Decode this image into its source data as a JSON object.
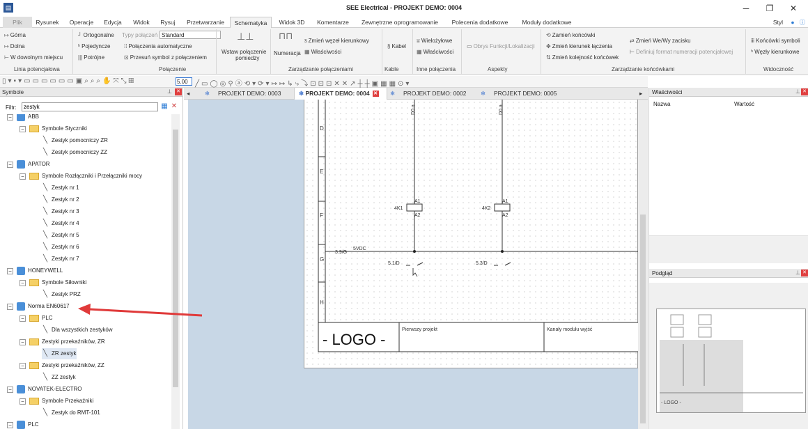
{
  "app": {
    "title": "SEE Electrical - PROJEKT DEMO: 0004",
    "style_label": "Styl"
  },
  "ribbon_tabs": [
    "Plik",
    "Rysunek",
    "Operacje",
    "Edycja",
    "Widok",
    "Rysuj",
    "Przetwarzanie",
    "Schematyka",
    "Widok 3D",
    "Komentarze",
    "Zewnętrzne oprogramowanie",
    "Polecenia dodatkowe",
    "Moduły dodatkowe"
  ],
  "ribbon": {
    "linia": {
      "gorna": "Górna",
      "dolna": "Dolna",
      "dowolne": "W dowolnym miejscu",
      "label": "Linia potencjałowa"
    },
    "polaczenie": {
      "ortogonalne": "Ortogonalne",
      "typy": "Typy połączeń",
      "combo": "Standard",
      "pojedyncze": "Pojedyncze",
      "automatyczne": "Połączenia automatyczne",
      "potrojne": "Potrójne",
      "przesun": "Przesuń symbol z połączeniem",
      "label": "Połączenie"
    },
    "wstaw": {
      "line1": "Wstaw połączenie",
      "line2": "pomiedzy"
    },
    "numeracja": "Numeracja",
    "zarzadzanie": {
      "zmien_wezel": "Zmień węzeł kierunkowy",
      "wlasciwosci": "Właściwości",
      "label": "Zarządzanie połączeniami"
    },
    "kabel": {
      "kabel": "Kabel",
      "label": "Kable"
    },
    "inne": {
      "wielozylowe": "Wielożyłowe",
      "wlasciwosci": "Właściwości",
      "label": "Inne połączenia"
    },
    "aspekty": {
      "obrys": "Obrys Funkcji/Lokalizacji",
      "label": "Aspekty"
    },
    "koncowki": {
      "zamien": "Zamień końcówki",
      "kierunek": "Zmień kierunek łączenia",
      "kolejnosc": "Zmień kolejność końcówek",
      "we_wy": "Zmień We/Wy zacisku",
      "format": "Definiuj format numeracji potencjałowej",
      "label": "Zarządzanie końcówkami"
    },
    "widocznosc": {
      "symbole": "Końcówki symboli",
      "wezly": "Węzły kierunkowe",
      "label": "Widoczność"
    }
  },
  "toolbar": {
    "zoom": "5.00"
  },
  "symbols_panel": {
    "title": "Symbole",
    "filter_label": "Filtr:",
    "filter_value": "zestyk",
    "tree": [
      {
        "level": 0,
        "type": "lib",
        "label": "ABB"
      },
      {
        "level": 1,
        "type": "folder",
        "label": "Symbole Styczniki"
      },
      {
        "level": 2,
        "type": "sym",
        "label": "Zestyk pomocniczy ZR"
      },
      {
        "level": 2,
        "type": "sym",
        "label": "Zestyk pomocniczy ZZ"
      },
      {
        "level": 0,
        "type": "lib",
        "label": "APATOR"
      },
      {
        "level": 1,
        "type": "folder",
        "label": "Symbole Rozłączniki i Przełączniki mocy"
      },
      {
        "level": 2,
        "type": "sym",
        "label": "Zestyk nr 1"
      },
      {
        "level": 2,
        "type": "sym",
        "label": "Zestyk nr 2"
      },
      {
        "level": 2,
        "type": "sym",
        "label": "Zestyk nr 3"
      },
      {
        "level": 2,
        "type": "sym",
        "label": "Zestyk nr 4"
      },
      {
        "level": 2,
        "type": "sym",
        "label": "Zestyk nr 5"
      },
      {
        "level": 2,
        "type": "sym",
        "label": "Zestyk nr 6"
      },
      {
        "level": 2,
        "type": "sym",
        "label": "Zestyk nr 7"
      },
      {
        "level": 0,
        "type": "lib",
        "label": "HONEYWELL"
      },
      {
        "level": 1,
        "type": "folder",
        "label": "Symbole Siłowniki"
      },
      {
        "level": 2,
        "type": "sym",
        "label": "Zestyk PRZ"
      },
      {
        "level": 0,
        "type": "lib",
        "label": "Norma EN60617"
      },
      {
        "level": 1,
        "type": "folder",
        "label": "PLC"
      },
      {
        "level": 2,
        "type": "sym",
        "label": "Dla wszystkich zestyków"
      },
      {
        "level": 1,
        "type": "folder",
        "label": "Zestyki przekaźników, ZR"
      },
      {
        "level": 2,
        "type": "sym",
        "label": "ZR zestyk",
        "selected": true
      },
      {
        "level": 1,
        "type": "folder",
        "label": "Zestyki przekaźników, ZZ"
      },
      {
        "level": 2,
        "type": "sym",
        "label": "ZZ zestyk"
      },
      {
        "level": 0,
        "type": "lib",
        "label": "NOVATEK-ELECTRO"
      },
      {
        "level": 1,
        "type": "folder",
        "label": "Symbole Przekaźniki"
      },
      {
        "level": 2,
        "type": "sym",
        "label": "Zestyk do RMT-101"
      },
      {
        "level": 0,
        "type": "lib",
        "label": "PLC"
      }
    ]
  },
  "doc_tabs": [
    "PROJEKT DEMO: 0003",
    "PROJEKT DEMO: 0004",
    "PROJEKT DEMO: 0002",
    "PROJEKT DEMO: 0005"
  ],
  "schematic": {
    "rows": [
      "D",
      "E",
      "F",
      "G",
      "H"
    ],
    "coil1": "4K1",
    "coil2": "4K2",
    "a1": "A1",
    "a2": "A2",
    "top1": "D0.a",
    "top2": "D0.a",
    "supply_ref": "3.9/G",
    "supply": "5VDC",
    "ref1": "5.1/D",
    "ref2": "5.3/D",
    "logo": "- LOGO -",
    "project": "Pierwszy projekt",
    "sheet_title": "Kanały modułu wyjść"
  },
  "properties_panel": {
    "title": "Właściwości",
    "col_name": "Nazwa",
    "col_value": "Wartość"
  },
  "preview_panel": {
    "title": "Podgląd",
    "logo": "- LOGO -"
  },
  "colors": {
    "accent": "#2b5797",
    "arrow": "#e03a3a",
    "canvas": "#c8d7e6"
  }
}
